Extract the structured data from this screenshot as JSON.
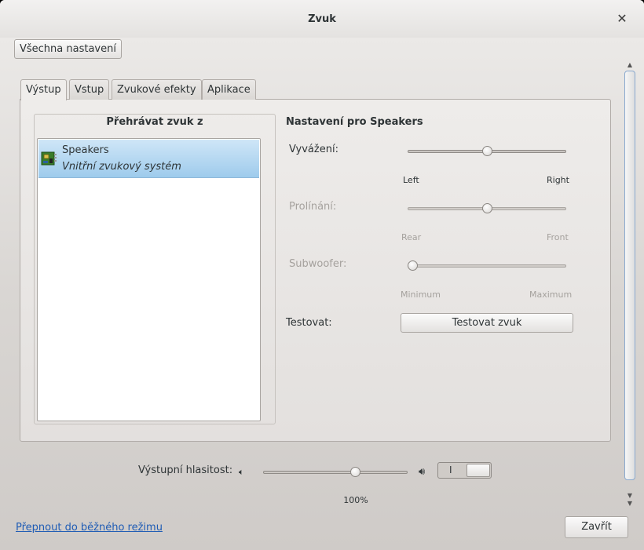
{
  "window": {
    "title": "Zvuk"
  },
  "toolbar": {
    "all_settings_label": "Všechna nastavení"
  },
  "tabs": [
    {
      "label": "Výstup",
      "active": true
    },
    {
      "label": "Vstup",
      "active": false
    },
    {
      "label": "Zvukové efekty",
      "active": false
    },
    {
      "label": "Aplikace",
      "active": false
    }
  ],
  "output": {
    "play_from_label": "Přehrávat zvuk z",
    "devices": [
      {
        "name": "Speakers",
        "description": "Vnitřní zvukový systém",
        "selected": true,
        "icon": "sound-card-icon"
      }
    ],
    "settings_heading": "Nastavení pro Speakers",
    "balance": {
      "label": "Vyvážení:",
      "min_label": "Left",
      "max_label": "Right",
      "value": 0.5,
      "enabled": true
    },
    "fade": {
      "label": "Prolínání:",
      "min_label": "Rear",
      "max_label": "Front",
      "value": 0.5,
      "enabled": false
    },
    "subwoofer": {
      "label": "Subwoofer:",
      "min_label": "Minimum",
      "max_label": "Maximum",
      "value": 0.0,
      "enabled": false
    },
    "test": {
      "label": "Testovat:",
      "button_label": "Testovat zvuk"
    }
  },
  "volume": {
    "label": "Výstupní hlasitost:",
    "value_percent": 100,
    "value_text": "100%",
    "slider_fraction": 0.65,
    "mute_switch_on": true,
    "mute_on_mark": "I",
    "low_icon": "speaker-low-icon",
    "high_icon": "speaker-high-icon"
  },
  "footer": {
    "mode_link": "Přepnout do běžného režimu",
    "close_label": "Zavřít"
  },
  "colors": {
    "selection": "#9ecbec",
    "link": "#1f5cb5",
    "scrollbar_border": "#8aa9cf"
  }
}
